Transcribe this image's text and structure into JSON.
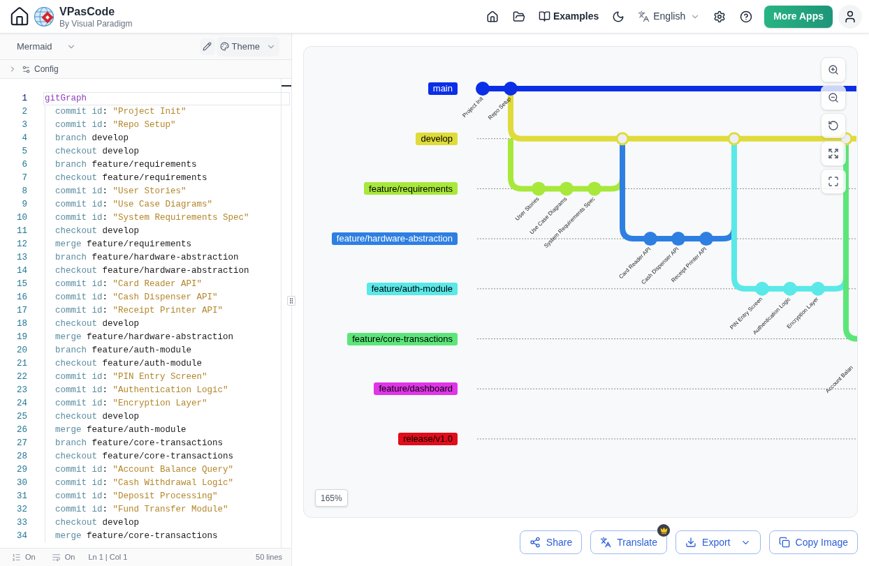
{
  "header": {
    "app_name": "VPasCode",
    "byline": "By Visual Paradigm",
    "examples": "Examples",
    "language": "English",
    "more_apps": "More Apps"
  },
  "editor": {
    "language": "Mermaid",
    "theme": "Theme",
    "config": {
      "label": "Config",
      "expanded": false
    },
    "lines": [
      {
        "number": "1",
        "indented": false,
        "active": true,
        "tokens": [
          {
            "kind": "graph",
            "text": "gitGraph"
          }
        ]
      },
      {
        "number": "2",
        "indented": true,
        "active": false,
        "tokens": [
          {
            "kind": "keyword",
            "text": "commit id"
          },
          {
            "kind": "plain",
            "text": ": "
          },
          {
            "kind": "string",
            "text": "\"Project Init\""
          }
        ]
      },
      {
        "number": "3",
        "indented": true,
        "active": false,
        "tokens": [
          {
            "kind": "keyword",
            "text": "commit id"
          },
          {
            "kind": "plain",
            "text": ": "
          },
          {
            "kind": "string",
            "text": "\"Repo Setup\""
          }
        ]
      },
      {
        "number": "4",
        "indented": true,
        "active": false,
        "tokens": [
          {
            "kind": "keyword",
            "text": "branch"
          },
          {
            "kind": "plain",
            "text": " develop"
          }
        ]
      },
      {
        "number": "5",
        "indented": true,
        "active": false,
        "tokens": [
          {
            "kind": "keyword",
            "text": "checkout"
          },
          {
            "kind": "plain",
            "text": " develop"
          }
        ]
      },
      {
        "number": "6",
        "indented": true,
        "active": false,
        "tokens": [
          {
            "kind": "keyword",
            "text": "branch"
          },
          {
            "kind": "plain",
            "text": " feature/requirements"
          }
        ]
      },
      {
        "number": "7",
        "indented": true,
        "active": false,
        "tokens": [
          {
            "kind": "keyword",
            "text": "checkout"
          },
          {
            "kind": "plain",
            "text": " feature/requirements"
          }
        ]
      },
      {
        "number": "8",
        "indented": true,
        "active": false,
        "tokens": [
          {
            "kind": "keyword",
            "text": "commit id"
          },
          {
            "kind": "plain",
            "text": ": "
          },
          {
            "kind": "string",
            "text": "\"User Stories\""
          }
        ]
      },
      {
        "number": "9",
        "indented": true,
        "active": false,
        "tokens": [
          {
            "kind": "keyword",
            "text": "commit id"
          },
          {
            "kind": "plain",
            "text": ": "
          },
          {
            "kind": "string",
            "text": "\"Use Case Diagrams\""
          }
        ]
      },
      {
        "number": "10",
        "indented": true,
        "active": false,
        "tokens": [
          {
            "kind": "keyword",
            "text": "commit id"
          },
          {
            "kind": "plain",
            "text": ": "
          },
          {
            "kind": "string",
            "text": "\"System Requirements Spec\""
          }
        ]
      },
      {
        "number": "11",
        "indented": true,
        "active": false,
        "tokens": [
          {
            "kind": "keyword",
            "text": "checkout"
          },
          {
            "kind": "plain",
            "text": " develop"
          }
        ]
      },
      {
        "number": "12",
        "indented": true,
        "active": false,
        "tokens": [
          {
            "kind": "keyword",
            "text": "merge"
          },
          {
            "kind": "plain",
            "text": " feature/requirements"
          }
        ]
      },
      {
        "number": "13",
        "indented": true,
        "active": false,
        "tokens": [
          {
            "kind": "keyword",
            "text": "branch"
          },
          {
            "kind": "plain",
            "text": " feature/hardware-abstraction"
          }
        ]
      },
      {
        "number": "14",
        "indented": true,
        "active": false,
        "tokens": [
          {
            "kind": "keyword",
            "text": "checkout"
          },
          {
            "kind": "plain",
            "text": " feature/hardware-abstraction"
          }
        ]
      },
      {
        "number": "15",
        "indented": true,
        "active": false,
        "tokens": [
          {
            "kind": "keyword",
            "text": "commit id"
          },
          {
            "kind": "plain",
            "text": ": "
          },
          {
            "kind": "string",
            "text": "\"Card Reader API\""
          }
        ]
      },
      {
        "number": "16",
        "indented": true,
        "active": false,
        "tokens": [
          {
            "kind": "keyword",
            "text": "commit id"
          },
          {
            "kind": "plain",
            "text": ": "
          },
          {
            "kind": "string",
            "text": "\"Cash Dispenser API\""
          }
        ]
      },
      {
        "number": "17",
        "indented": true,
        "active": false,
        "tokens": [
          {
            "kind": "keyword",
            "text": "commit id"
          },
          {
            "kind": "plain",
            "text": ": "
          },
          {
            "kind": "string",
            "text": "\"Receipt Printer API\""
          }
        ]
      },
      {
        "number": "18",
        "indented": true,
        "active": false,
        "tokens": [
          {
            "kind": "keyword",
            "text": "checkout"
          },
          {
            "kind": "plain",
            "text": " develop"
          }
        ]
      },
      {
        "number": "19",
        "indented": true,
        "active": false,
        "tokens": [
          {
            "kind": "keyword",
            "text": "merge"
          },
          {
            "kind": "plain",
            "text": " feature/hardware-abstraction"
          }
        ]
      },
      {
        "number": "20",
        "indented": true,
        "active": false,
        "tokens": [
          {
            "kind": "keyword",
            "text": "branch"
          },
          {
            "kind": "plain",
            "text": " feature/auth-module"
          }
        ]
      },
      {
        "number": "21",
        "indented": true,
        "active": false,
        "tokens": [
          {
            "kind": "keyword",
            "text": "checkout"
          },
          {
            "kind": "plain",
            "text": " feature/auth-module"
          }
        ]
      },
      {
        "number": "22",
        "indented": true,
        "active": false,
        "tokens": [
          {
            "kind": "keyword",
            "text": "commit id"
          },
          {
            "kind": "plain",
            "text": ": "
          },
          {
            "kind": "string",
            "text": "\"PIN Entry Screen\""
          }
        ]
      },
      {
        "number": "23",
        "indented": true,
        "active": false,
        "tokens": [
          {
            "kind": "keyword",
            "text": "commit id"
          },
          {
            "kind": "plain",
            "text": ": "
          },
          {
            "kind": "string",
            "text": "\"Authentication Logic\""
          }
        ]
      },
      {
        "number": "24",
        "indented": true,
        "active": false,
        "tokens": [
          {
            "kind": "keyword",
            "text": "commit id"
          },
          {
            "kind": "plain",
            "text": ": "
          },
          {
            "kind": "string",
            "text": "\"Encryption Layer\""
          }
        ]
      },
      {
        "number": "25",
        "indented": true,
        "active": false,
        "tokens": [
          {
            "kind": "keyword",
            "text": "checkout"
          },
          {
            "kind": "plain",
            "text": " develop"
          }
        ]
      },
      {
        "number": "26",
        "indented": true,
        "active": false,
        "tokens": [
          {
            "kind": "keyword",
            "text": "merge"
          },
          {
            "kind": "plain",
            "text": " feature/auth-module"
          }
        ]
      },
      {
        "number": "27",
        "indented": true,
        "active": false,
        "tokens": [
          {
            "kind": "keyword",
            "text": "branch"
          },
          {
            "kind": "plain",
            "text": " feature/core-transactions"
          }
        ]
      },
      {
        "number": "28",
        "indented": true,
        "active": false,
        "tokens": [
          {
            "kind": "keyword",
            "text": "checkout"
          },
          {
            "kind": "plain",
            "text": " feature/core-transactions"
          }
        ]
      },
      {
        "number": "29",
        "indented": true,
        "active": false,
        "tokens": [
          {
            "kind": "keyword",
            "text": "commit id"
          },
          {
            "kind": "plain",
            "text": ": "
          },
          {
            "kind": "string",
            "text": "\"Account Balance Query\""
          }
        ]
      },
      {
        "number": "30",
        "indented": true,
        "active": false,
        "tokens": [
          {
            "kind": "keyword",
            "text": "commit id"
          },
          {
            "kind": "plain",
            "text": ": "
          },
          {
            "kind": "string",
            "text": "\"Cash Withdrawal Logic\""
          }
        ]
      },
      {
        "number": "31",
        "indented": true,
        "active": false,
        "tokens": [
          {
            "kind": "keyword",
            "text": "commit id"
          },
          {
            "kind": "plain",
            "text": ": "
          },
          {
            "kind": "string",
            "text": "\"Deposit Processing\""
          }
        ]
      },
      {
        "number": "32",
        "indented": true,
        "active": false,
        "tokens": [
          {
            "kind": "keyword",
            "text": "commit id"
          },
          {
            "kind": "plain",
            "text": ": "
          },
          {
            "kind": "string",
            "text": "\"Fund Transfer Module\""
          }
        ]
      },
      {
        "number": "33",
        "indented": true,
        "active": false,
        "tokens": [
          {
            "kind": "keyword",
            "text": "checkout"
          },
          {
            "kind": "plain",
            "text": " develop"
          }
        ]
      },
      {
        "number": "34",
        "indented": true,
        "active": false,
        "tokens": [
          {
            "kind": "keyword",
            "text": "merge"
          },
          {
            "kind": "plain",
            "text": " feature/core-transactions"
          }
        ]
      }
    ],
    "status": {
      "line_numbers": "On",
      "word_wrap": "On",
      "position": "Ln 1 | Col 1",
      "line_count": "50 lines"
    }
  },
  "diagram": {
    "branches": [
      {
        "name": "main",
        "color": "#0b2fe6",
        "light_text": true,
        "commits": [
          {
            "kind": "commit",
            "label": "Project Init"
          },
          {
            "kind": "commit",
            "label": "Repo Setup"
          }
        ]
      },
      {
        "name": "develop",
        "color": "#dfdb3a",
        "light_text": false,
        "commits": [
          {
            "kind": "merge"
          },
          {
            "kind": "merge"
          },
          {
            "kind": "merge"
          }
        ]
      },
      {
        "name": "feature/requirements",
        "color": "#a7e83b",
        "light_text": false,
        "commits": [
          {
            "kind": "commit",
            "label": "User Stories"
          },
          {
            "kind": "commit",
            "label": "Use Case Diagrams"
          },
          {
            "kind": "commit",
            "label": "System Requirements Spec"
          }
        ]
      },
      {
        "name": "feature/hardware-abstraction",
        "color": "#2e7fe2",
        "light_text": true,
        "commits": [
          {
            "kind": "commit",
            "label": "Card Reader API"
          },
          {
            "kind": "commit",
            "label": "Cash Dispenser API"
          },
          {
            "kind": "commit",
            "label": "Receipt Printer API"
          }
        ]
      },
      {
        "name": "feature/auth-module",
        "color": "#5ae8e8",
        "light_text": false,
        "commits": [
          {
            "kind": "commit",
            "label": "PIN Entry Screen"
          },
          {
            "kind": "commit",
            "label": "Authentication Logic"
          },
          {
            "kind": "commit",
            "label": "Encryption Layer"
          }
        ]
      },
      {
        "name": "feature/core-transactions",
        "color": "#5ce67a",
        "light_text": false,
        "commits": [
          {
            "kind": "clipped",
            "label": "Account Balan"
          }
        ]
      },
      {
        "name": "feature/dashboard",
        "color": "#e034e8",
        "light_text": false
      },
      {
        "name": "release/v1.0",
        "color": "#e10d1b",
        "light_text": false
      }
    ],
    "zoom": "165%"
  },
  "actions": [
    {
      "kind": "share",
      "label": "Share",
      "premium": false,
      "dropdown": false
    },
    {
      "kind": "translate",
      "label": "Translate",
      "premium": true,
      "dropdown": false
    },
    {
      "kind": "export",
      "label": "Export",
      "premium": false,
      "dropdown": true
    },
    {
      "kind": "copy",
      "label": "Copy Image",
      "premium": false,
      "dropdown": false
    }
  ]
}
